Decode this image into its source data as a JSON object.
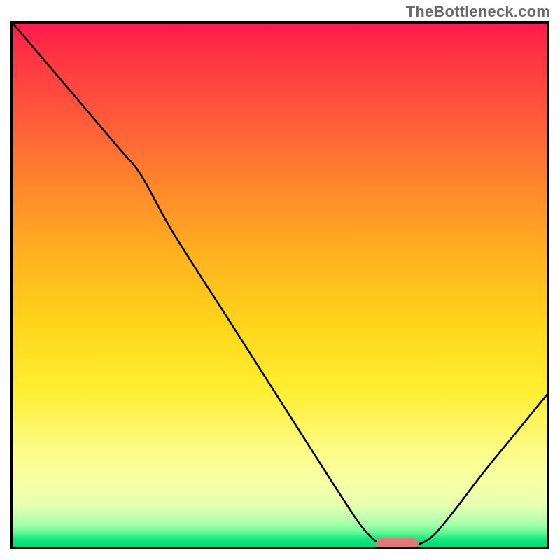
{
  "watermark": "TheBottleneck.com",
  "plot": {
    "inner_width": 762,
    "inner_height": 747
  },
  "chart_data": {
    "type": "line",
    "title": "",
    "xlabel": "",
    "ylabel": "",
    "xlim": [
      0,
      100
    ],
    "ylim": [
      0,
      100
    ],
    "gradient_note": "vertical gradient red→orange→yellow→green indicating bottleneck severity (top=high, bottom=low)",
    "series": [
      {
        "name": "bottleneck-curve",
        "x": [
          0,
          10,
          20,
          24,
          30,
          40,
          50,
          60,
          66,
          70,
          74,
          78,
          82,
          88,
          94,
          100
        ],
        "y": [
          100,
          88,
          76,
          71,
          60,
          44,
          28,
          12,
          3,
          0,
          0,
          1.5,
          6,
          14,
          21.5,
          29
        ]
      }
    ],
    "green_band_y_range": [
      0,
      2.5
    ],
    "optimal_marker": {
      "x_start": 68,
      "x_end": 76,
      "y": 0.5,
      "color": "#e07a78"
    }
  }
}
